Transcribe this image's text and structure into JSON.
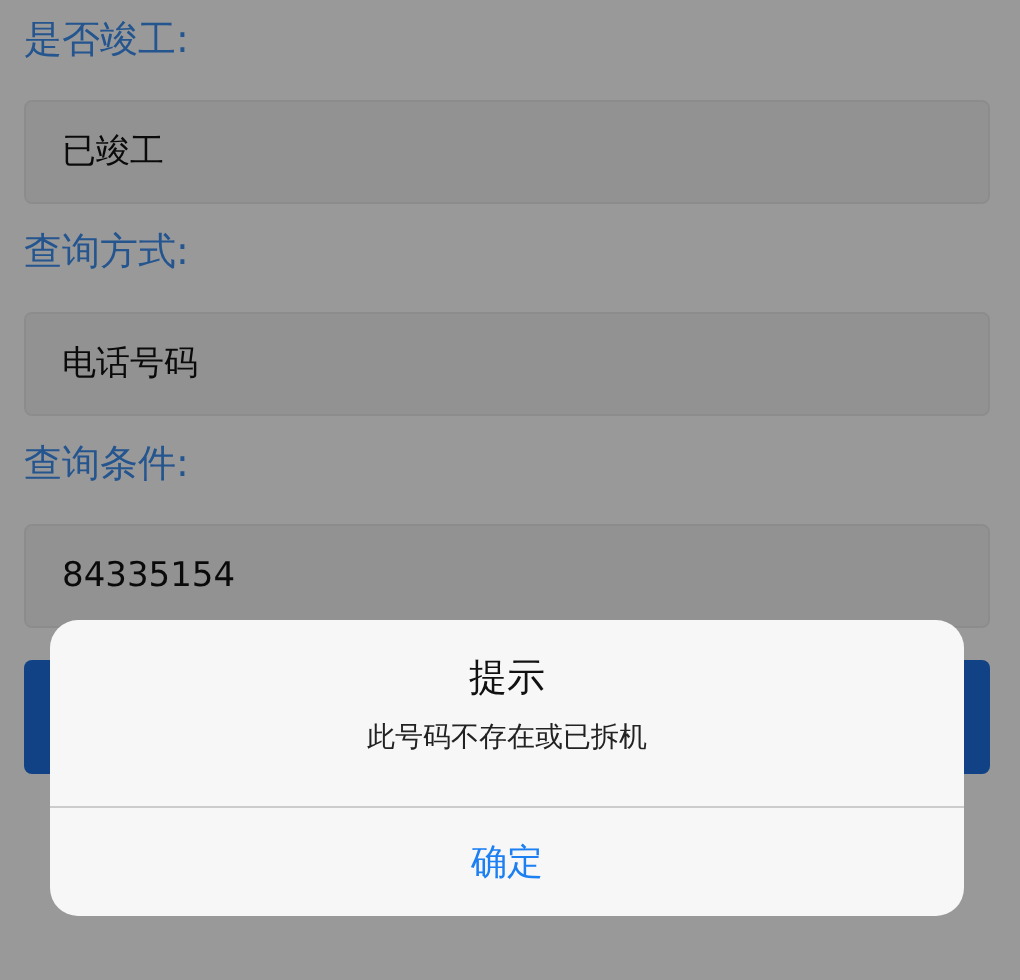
{
  "form": {
    "fields": [
      {
        "label": "是否竣工:",
        "value": "已竣工"
      },
      {
        "label": "查询方式:",
        "value": "电话号码"
      },
      {
        "label": "查询条件:",
        "value": "84335154"
      }
    ]
  },
  "dialog": {
    "title": "提示",
    "message": "此号码不存在或已拆机",
    "buttons": [
      "确定"
    ]
  }
}
